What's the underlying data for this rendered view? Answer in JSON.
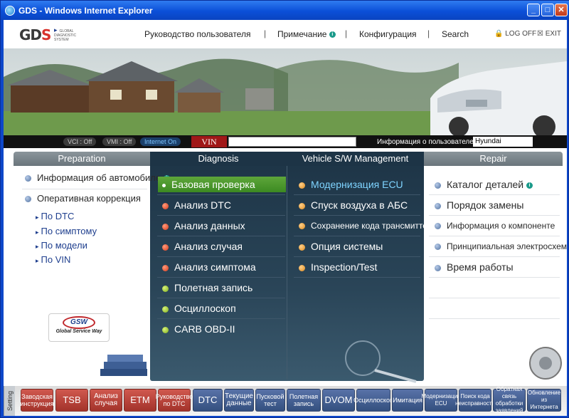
{
  "window": {
    "title": "GDS - Windows Internet Explorer",
    "min": "_",
    "max": "□",
    "close": "✕"
  },
  "logo": {
    "mark": "GD",
    "mark_s": "S",
    "subtitle": "GLOBAL DIAGNOSTIC SYSTEM"
  },
  "topnav": {
    "user_guide": "Руководство пользователя",
    "notes": "Примечание",
    "configuration": "Конфигурация",
    "search": "Search",
    "logoff": "LOG OFF",
    "exit": "EXIT",
    "separator": "|"
  },
  "status": {
    "vci": "VCI : Off",
    "vmi": "VMI : Off",
    "internet": "Internet On",
    "vin_label": "VIN",
    "vin_value": "",
    "user_info_label": "Информация о пользователе",
    "user_info_value": "Hyundai"
  },
  "columns": {
    "preparation": "Preparation",
    "diagnosis": "Diagnosis",
    "vehicle_sw": "Vehicle S/W Management",
    "repair": "Repair"
  },
  "preparation_items": [
    {
      "label": "Информация об автомобиле",
      "info": "i"
    },
    {
      "label": "Оперативная коррекция"
    }
  ],
  "preparation_sub": [
    "По DTC",
    "По симптому",
    "По модели",
    "По VIN"
  ],
  "diagnosis_items": [
    {
      "label": "Базовая проверка",
      "color": "green"
    },
    {
      "label": "Анализ DTC",
      "color": "red"
    },
    {
      "label": "Анализ данных",
      "color": "red"
    },
    {
      "label": "Анализ случая",
      "color": "red"
    },
    {
      "label": "Анализ симптома",
      "color": "red"
    },
    {
      "label": "Полетная запись",
      "color": "green"
    },
    {
      "label": "Осциллоскоп",
      "color": "green"
    },
    {
      "label": "CARB OBD-II",
      "color": "green"
    }
  ],
  "vehicle_sw_items": [
    {
      "label": "Модернизация ECU"
    },
    {
      "label": "Спуск воздуха в АБС"
    },
    {
      "label": "Сохранение кода трансмиттера"
    },
    {
      "label": "Опция системы"
    },
    {
      "label": "Inspection/Test"
    }
  ],
  "repair_items": [
    {
      "label": "Каталог деталей",
      "info": "i"
    },
    {
      "label": "Порядок замены"
    },
    {
      "label": "Информация о компоненте"
    },
    {
      "label": "Принципиальная электросхема"
    },
    {
      "label": "Время работы"
    }
  ],
  "gsw": {
    "logo": "GSW",
    "caption": "Global Service Way"
  },
  "toolbar": {
    "setting": "Setting",
    "buttons": [
      {
        "label": "Заводская инструкция"
      },
      {
        "label": "TSB"
      },
      {
        "label": "Анализ случая"
      },
      {
        "label": "ETM"
      },
      {
        "label": "Руководство по DTC"
      },
      {
        "label": "DTC"
      },
      {
        "label": "Текущие данные"
      },
      {
        "label": "Пусковой тест"
      },
      {
        "label": "Полетная запись"
      },
      {
        "label": "DVOM"
      },
      {
        "label": "Осциллоскоп"
      },
      {
        "label": "Имитация"
      },
      {
        "label": "Модернизация ECU"
      },
      {
        "label": "Поиск кода неисправности"
      },
      {
        "label": "Обратная связь обработки заявлений"
      },
      {
        "label": "Обновление из Интернета"
      }
    ]
  },
  "colors": {
    "selected": "#4a9a2c",
    "dark_panel": "#2a4558",
    "toolbar_red": "#b33f36",
    "toolbar_blue": "#3f5a8c"
  }
}
